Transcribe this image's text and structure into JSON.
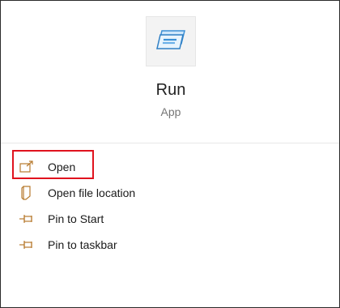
{
  "app": {
    "name": "Run",
    "type": "App",
    "icon": "run-dialog-icon"
  },
  "menu": {
    "items": [
      {
        "label": "Open",
        "icon": "open-arrow-icon",
        "highlighted": true
      },
      {
        "label": "Open file location",
        "icon": "file-location-icon"
      },
      {
        "label": "Pin to Start",
        "icon": "pin-icon"
      },
      {
        "label": "Pin to taskbar",
        "icon": "pin-icon"
      }
    ]
  },
  "colors": {
    "highlight": "#e0131e",
    "icon_accent": "#b77a2e",
    "app_icon_blue": "#3a8fd6"
  }
}
